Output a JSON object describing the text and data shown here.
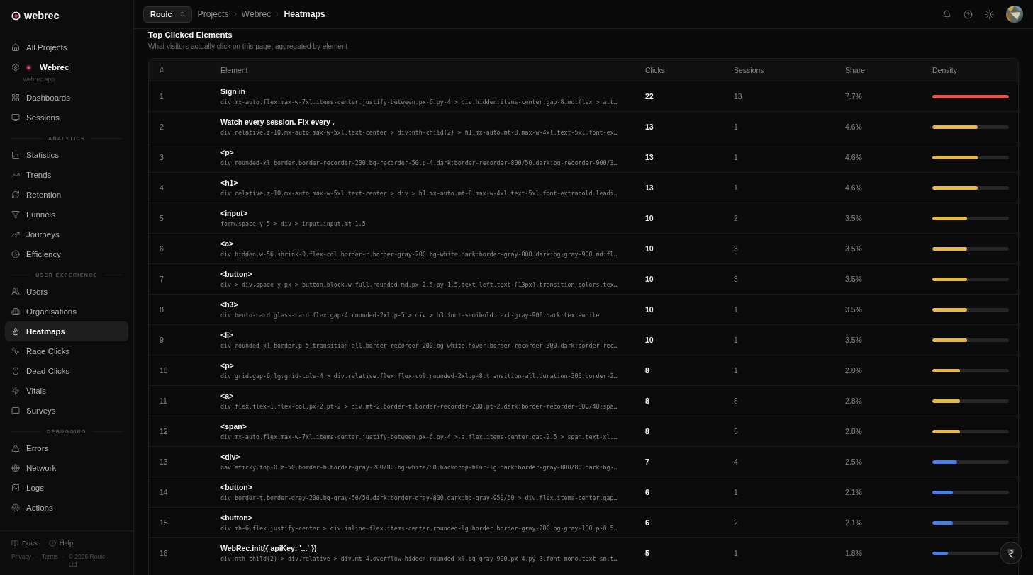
{
  "logo": {
    "text": "webrec"
  },
  "header": {
    "workspace": {
      "label": "Rouic"
    },
    "breadcrumb": [
      {
        "label": "Projects",
        "current": false
      },
      {
        "label": "Webrec",
        "current": false
      },
      {
        "label": "Heatmaps",
        "current": true
      }
    ]
  },
  "sidebar": {
    "top_items": [
      {
        "label": "All Projects",
        "selected": false
      }
    ],
    "project": {
      "name": "Webrec",
      "domain": "webrec.app"
    },
    "main_items": [
      {
        "label": "Dashboards",
        "selected": false
      },
      {
        "label": "Sessions",
        "selected": false
      }
    ],
    "sections": [
      {
        "title": "ANALYTICS",
        "items": [
          {
            "label": "Statistics",
            "selected": false
          },
          {
            "label": "Trends",
            "selected": false
          },
          {
            "label": "Retention",
            "selected": false
          },
          {
            "label": "Funnels",
            "selected": false
          },
          {
            "label": "Journeys",
            "selected": false
          },
          {
            "label": "Efficiency",
            "selected": false
          }
        ]
      },
      {
        "title": "USER EXPERIENCE",
        "items": [
          {
            "label": "Users",
            "selected": false
          },
          {
            "label": "Organisations",
            "selected": false
          },
          {
            "label": "Heatmaps",
            "selected": true
          },
          {
            "label": "Rage Clicks",
            "selected": false
          },
          {
            "label": "Dead Clicks",
            "selected": false
          },
          {
            "label": "Vitals",
            "selected": false
          },
          {
            "label": "Surveys",
            "selected": false
          }
        ]
      },
      {
        "title": "DEBUGGING",
        "items": [
          {
            "label": "Errors",
            "selected": false
          },
          {
            "label": "Network",
            "selected": false
          },
          {
            "label": "Logs",
            "selected": false
          },
          {
            "label": "Actions",
            "selected": false
          }
        ]
      }
    ],
    "footer": {
      "links": [
        {
          "label": "Docs"
        },
        {
          "label": "Help"
        }
      ],
      "legal": [
        {
          "kind": "link",
          "text": "Privacy"
        },
        {
          "kind": "separator",
          "text": "·"
        },
        {
          "kind": "link",
          "text": "Terms"
        },
        {
          "kind": "separator",
          "text": "·"
        },
        {
          "kind": "text",
          "text": "© 2026 Rouic Ltd"
        }
      ]
    }
  },
  "content": {
    "title": "Top Clicked Elements",
    "subtitle": "What visitors actually click on this page, aggregated by element",
    "table": {
      "columns": [
        "#",
        "Element",
        "Clicks",
        "Sessions",
        "Share",
        "Density"
      ],
      "rows": [
        {
          "rank": "1",
          "element": "Sign in",
          "selector": "div.mx-auto.flex.max-w-7xl.items-center.justify-between.px-6.py-4 > div.hidden.items-center.gap-8.md:flex > a.t…",
          "clicks": "22",
          "sessions": "13",
          "share": "7.7%",
          "level": 1,
          "color": "#e5534b"
        },
        {
          "rank": "2",
          "element": "Watch every session. Fix every .",
          "selector": "div.relative.z-10.mx-auto.max-w-5xl.text-center > div:nth-child(2) > h1.mx-auto.mt-8.max-w-4xl.text-5xl.font-ex…",
          "clicks": "13",
          "sessions": "1",
          "share": "4.6%",
          "level": 0.59,
          "color": "#e6b84a"
        },
        {
          "rank": "3",
          "element": "<p>",
          "selector": "div.rounded-xl.border.border-recorder-200.bg-recorder-50.p-4.dark:border-recorder-800/50.dark:bg-recorder-900/3…",
          "clicks": "13",
          "sessions": "1",
          "share": "4.6%",
          "level": 0.59,
          "color": "#e6b84a"
        },
        {
          "rank": "4",
          "element": "<h1>",
          "selector": "div.relative.z-10.mx-auto.max-w-5xl.text-center > div > h1.mx-auto.mt-8.max-w-4xl.text-5xl.font-extrabold.leadi…",
          "clicks": "13",
          "sessions": "1",
          "share": "4.6%",
          "level": 0.59,
          "color": "#e6b84a"
        },
        {
          "rank": "5",
          "element": "<input>",
          "selector": "form.space-y-5 > div > input.input.mt-1.5",
          "clicks": "10",
          "sessions": "2",
          "share": "3.5%",
          "level": 0.45,
          "color": "#e6b84a"
        },
        {
          "rank": "6",
          "element": "<a>",
          "selector": "div.hidden.w-56.shrink-0.flex-col.border-r.border-gray-200.bg-white.dark:border-gray-800.dark:bg-gray-900.md:fl…",
          "clicks": "10",
          "sessions": "3",
          "share": "3.5%",
          "level": 0.45,
          "color": "#e6b84a"
        },
        {
          "rank": "7",
          "element": "<button>",
          "selector": "div > div.space-y-px > button.block.w-full.rounded-md.px-2.5.py-1.5.text-left.text-[13px].transition-colors.tex…",
          "clicks": "10",
          "sessions": "3",
          "share": "3.5%",
          "level": 0.45,
          "color": "#e6b84a"
        },
        {
          "rank": "8",
          "element": "<h3>",
          "selector": "div.bento-card.glass-card.flex.gap-4.rounded-2xl.p-5 > div > h3.font-semibold.text-gray-900.dark:text-white",
          "clicks": "10",
          "sessions": "1",
          "share": "3.5%",
          "level": 0.45,
          "color": "#e6b84a"
        },
        {
          "rank": "9",
          "element": "<li>",
          "selector": "div.rounded-xl.border.p-5.transition-all.border-recorder-200.bg-white.hover:border-recorder-300.dark:border-rec…",
          "clicks": "10",
          "sessions": "1",
          "share": "3.5%",
          "level": 0.45,
          "color": "#e6b84a"
        },
        {
          "rank": "10",
          "element": "<p>",
          "selector": "div.grid.gap-6.lg:grid-cols-4 > div.relative.flex.flex-col.rounded-2xl.p-8.transition-all.duration-300.border-2…",
          "clicks": "8",
          "sessions": "1",
          "share": "2.8%",
          "level": 0.36,
          "color": "#e6b84a"
        },
        {
          "rank": "11",
          "element": "<a>",
          "selector": "div.flex.flex-1.flex-col.px-2.pt-2 > div.mt-2.border-t.border-recorder-200.pt-2.dark:border-recorder-800/40.spa…",
          "clicks": "8",
          "sessions": "6",
          "share": "2.8%",
          "level": 0.36,
          "color": "#e6b84a"
        },
        {
          "rank": "12",
          "element": "<span>",
          "selector": "div.mx-auto.flex.max-w-7xl.items-center.justify-between.px-6.py-4 > a.flex.items-center.gap-2.5 > span.text-xl.…",
          "clicks": "8",
          "sessions": "5",
          "share": "2.8%",
          "level": 0.36,
          "color": "#e6b84a"
        },
        {
          "rank": "13",
          "element": "<div>",
          "selector": "nav.sticky.top-0.z-50.border-b.border-gray-200/80.bg-white/80.backdrop-blur-lg.dark:border-gray-800/80.dark:bg-…",
          "clicks": "7",
          "sessions": "4",
          "share": "2.5%",
          "level": 0.32,
          "color": "#4a7ee6"
        },
        {
          "rank": "14",
          "element": "<button>",
          "selector": "div.border-t.border-gray-200.bg-gray-50/50.dark:border-gray-800.dark:bg-gray-950/50 > div.flex.items-center.gap…",
          "clicks": "6",
          "sessions": "1",
          "share": "2.1%",
          "level": 0.27,
          "color": "#4a7ee6"
        },
        {
          "rank": "15",
          "element": "<button>",
          "selector": "div.mb-6.flex.justify-center > div.inline-flex.items-center.rounded-lg.border.border-gray-200.bg-gray-100.p-0.5…",
          "clicks": "6",
          "sessions": "2",
          "share": "2.1%",
          "level": 0.27,
          "color": "#4a7ee6"
        },
        {
          "rank": "16",
          "element": "WebRec.init({ apiKey: '...' })",
          "selector": "div:nth-child(2) > div.relative > div.mt-4.overflow-hidden.rounded-xl.bg-gray-900.px-4.py-3.font-mono.text-sm.t…",
          "clicks": "5",
          "sessions": "1",
          "share": "1.8%",
          "level": 0.23,
          "color": "#4a7ee6"
        }
      ]
    }
  }
}
